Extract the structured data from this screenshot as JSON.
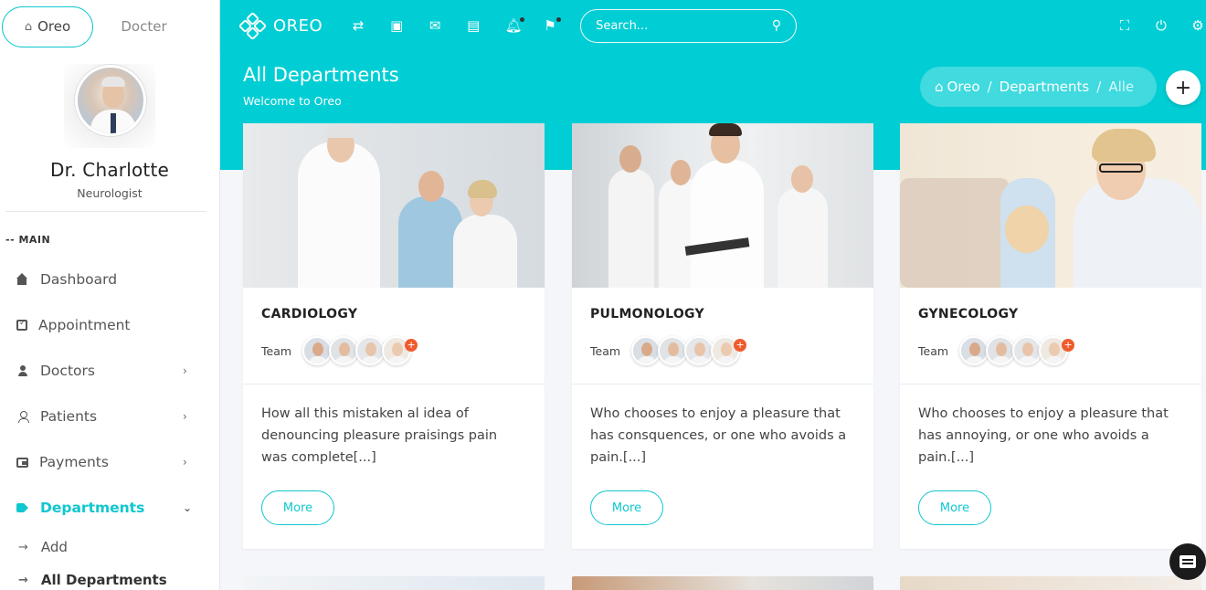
{
  "sidebar": {
    "tabs": [
      {
        "label": "Oreo"
      },
      {
        "label": "Docter"
      }
    ],
    "profile": {
      "name": "Dr. Charlotte",
      "role": "Neurologist"
    },
    "section_header": "-- MAIN",
    "items": [
      {
        "label": "Dashboard",
        "icon": "home-icon"
      },
      {
        "label": "Appointment",
        "icon": "calendar-check-icon"
      },
      {
        "label": "Doctors",
        "icon": "add-user-icon"
      },
      {
        "label": "Patients",
        "icon": "user-icon"
      },
      {
        "label": "Payments",
        "icon": "wallet-icon"
      },
      {
        "label": "Departments",
        "icon": "tag-icon"
      }
    ],
    "sub_items": [
      {
        "label": "Add"
      },
      {
        "label": "All Departments"
      }
    ]
  },
  "topbar": {
    "brand": "OREO",
    "search_placeholder": "Search..."
  },
  "header": {
    "title": "All Departments",
    "subtitle": "Welcome to Oreo",
    "breadcrumb": [
      "Oreo",
      "Departments",
      "Alle"
    ]
  },
  "cards": [
    {
      "title": "CARDIOLOGY",
      "team_label": "Team",
      "text": "How all this mistaken al idea of denouncing pleasure praisings pain was complete[...]",
      "button": "More"
    },
    {
      "title": "PULMONOLOGY",
      "team_label": "Team",
      "text": "Who chooses to enjoy a pleasure that has consquences, or one who avoids a pain.[...]",
      "button": "More"
    },
    {
      "title": "GYNECOLOGY",
      "team_label": "Team",
      "text": "Who chooses to enjoy a pleasure that has annoying, or one who avoids a pain.[...]",
      "button": "More"
    }
  ],
  "colors": {
    "accent": "#00ced4",
    "badge": "#ef5b2c"
  }
}
